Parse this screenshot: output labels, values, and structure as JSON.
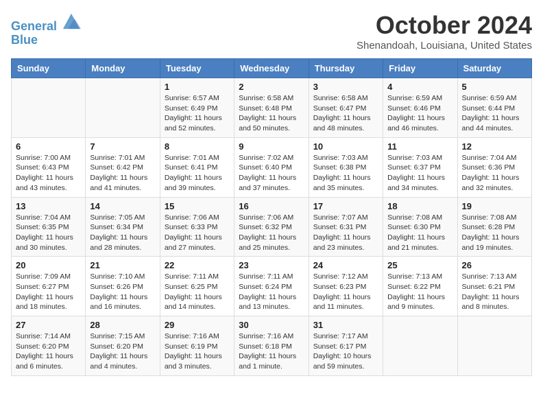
{
  "header": {
    "logo_line1": "General",
    "logo_line2": "Blue",
    "month": "October 2024",
    "location": "Shenandoah, Louisiana, United States"
  },
  "weekdays": [
    "Sunday",
    "Monday",
    "Tuesday",
    "Wednesday",
    "Thursday",
    "Friday",
    "Saturday"
  ],
  "weeks": [
    [
      {
        "day": "",
        "info": ""
      },
      {
        "day": "",
        "info": ""
      },
      {
        "day": "1",
        "info": "Sunrise: 6:57 AM\nSunset: 6:49 PM\nDaylight: 11 hours and 52 minutes."
      },
      {
        "day": "2",
        "info": "Sunrise: 6:58 AM\nSunset: 6:48 PM\nDaylight: 11 hours and 50 minutes."
      },
      {
        "day": "3",
        "info": "Sunrise: 6:58 AM\nSunset: 6:47 PM\nDaylight: 11 hours and 48 minutes."
      },
      {
        "day": "4",
        "info": "Sunrise: 6:59 AM\nSunset: 6:46 PM\nDaylight: 11 hours and 46 minutes."
      },
      {
        "day": "5",
        "info": "Sunrise: 6:59 AM\nSunset: 6:44 PM\nDaylight: 11 hours and 44 minutes."
      }
    ],
    [
      {
        "day": "6",
        "info": "Sunrise: 7:00 AM\nSunset: 6:43 PM\nDaylight: 11 hours and 43 minutes."
      },
      {
        "day": "7",
        "info": "Sunrise: 7:01 AM\nSunset: 6:42 PM\nDaylight: 11 hours and 41 minutes."
      },
      {
        "day": "8",
        "info": "Sunrise: 7:01 AM\nSunset: 6:41 PM\nDaylight: 11 hours and 39 minutes."
      },
      {
        "day": "9",
        "info": "Sunrise: 7:02 AM\nSunset: 6:40 PM\nDaylight: 11 hours and 37 minutes."
      },
      {
        "day": "10",
        "info": "Sunrise: 7:03 AM\nSunset: 6:38 PM\nDaylight: 11 hours and 35 minutes."
      },
      {
        "day": "11",
        "info": "Sunrise: 7:03 AM\nSunset: 6:37 PM\nDaylight: 11 hours and 34 minutes."
      },
      {
        "day": "12",
        "info": "Sunrise: 7:04 AM\nSunset: 6:36 PM\nDaylight: 11 hours and 32 minutes."
      }
    ],
    [
      {
        "day": "13",
        "info": "Sunrise: 7:04 AM\nSunset: 6:35 PM\nDaylight: 11 hours and 30 minutes."
      },
      {
        "day": "14",
        "info": "Sunrise: 7:05 AM\nSunset: 6:34 PM\nDaylight: 11 hours and 28 minutes."
      },
      {
        "day": "15",
        "info": "Sunrise: 7:06 AM\nSunset: 6:33 PM\nDaylight: 11 hours and 27 minutes."
      },
      {
        "day": "16",
        "info": "Sunrise: 7:06 AM\nSunset: 6:32 PM\nDaylight: 11 hours and 25 minutes."
      },
      {
        "day": "17",
        "info": "Sunrise: 7:07 AM\nSunset: 6:31 PM\nDaylight: 11 hours and 23 minutes."
      },
      {
        "day": "18",
        "info": "Sunrise: 7:08 AM\nSunset: 6:30 PM\nDaylight: 11 hours and 21 minutes."
      },
      {
        "day": "19",
        "info": "Sunrise: 7:08 AM\nSunset: 6:28 PM\nDaylight: 11 hours and 19 minutes."
      }
    ],
    [
      {
        "day": "20",
        "info": "Sunrise: 7:09 AM\nSunset: 6:27 PM\nDaylight: 11 hours and 18 minutes."
      },
      {
        "day": "21",
        "info": "Sunrise: 7:10 AM\nSunset: 6:26 PM\nDaylight: 11 hours and 16 minutes."
      },
      {
        "day": "22",
        "info": "Sunrise: 7:11 AM\nSunset: 6:25 PM\nDaylight: 11 hours and 14 minutes."
      },
      {
        "day": "23",
        "info": "Sunrise: 7:11 AM\nSunset: 6:24 PM\nDaylight: 11 hours and 13 minutes."
      },
      {
        "day": "24",
        "info": "Sunrise: 7:12 AM\nSunset: 6:23 PM\nDaylight: 11 hours and 11 minutes."
      },
      {
        "day": "25",
        "info": "Sunrise: 7:13 AM\nSunset: 6:22 PM\nDaylight: 11 hours and 9 minutes."
      },
      {
        "day": "26",
        "info": "Sunrise: 7:13 AM\nSunset: 6:21 PM\nDaylight: 11 hours and 8 minutes."
      }
    ],
    [
      {
        "day": "27",
        "info": "Sunrise: 7:14 AM\nSunset: 6:20 PM\nDaylight: 11 hours and 6 minutes."
      },
      {
        "day": "28",
        "info": "Sunrise: 7:15 AM\nSunset: 6:20 PM\nDaylight: 11 hours and 4 minutes."
      },
      {
        "day": "29",
        "info": "Sunrise: 7:16 AM\nSunset: 6:19 PM\nDaylight: 11 hours and 3 minutes."
      },
      {
        "day": "30",
        "info": "Sunrise: 7:16 AM\nSunset: 6:18 PM\nDaylight: 11 hours and 1 minute."
      },
      {
        "day": "31",
        "info": "Sunrise: 7:17 AM\nSunset: 6:17 PM\nDaylight: 10 hours and 59 minutes."
      },
      {
        "day": "",
        "info": ""
      },
      {
        "day": "",
        "info": ""
      }
    ]
  ]
}
